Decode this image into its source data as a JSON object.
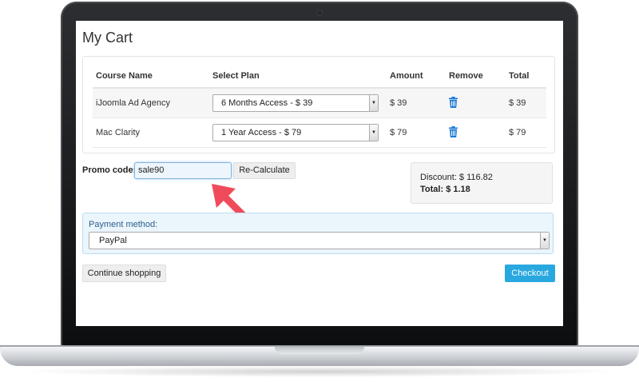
{
  "page": {
    "title": "My Cart"
  },
  "cart": {
    "headers": {
      "course": "Course Name",
      "plan": "Select Plan",
      "amount": "Amount",
      "remove": "Remove",
      "total": "Total"
    },
    "rows": [
      {
        "course": "iJoomla Ad Agency",
        "plan": "6 Months Access - $ 39",
        "amount": "$ 39",
        "total": "$ 39"
      },
      {
        "course": "Mac Clarity",
        "plan": "1 Year Access - $ 79",
        "amount": "$ 79",
        "total": "$ 79"
      }
    ]
  },
  "promo": {
    "label": "Promo code:",
    "value": "sale90",
    "recalc_label": "Re-Calculate"
  },
  "summary": {
    "discount": "Discount: $ 116.82",
    "total_label": "Total:",
    "total_value": "$ 1.18"
  },
  "payment": {
    "label": "Payment method:",
    "selected": "PayPal"
  },
  "actions": {
    "continue_label": "Continue shopping",
    "checkout_label": "Checkout"
  },
  "icons": {
    "remove": "trash-icon",
    "select_arrow": "chevron-down-icon",
    "annotation": "arrow-icon"
  },
  "colors": {
    "accent": "#29a8e0",
    "trash": "#1c7bd4",
    "annotation_arrow": "#f04b5a"
  }
}
